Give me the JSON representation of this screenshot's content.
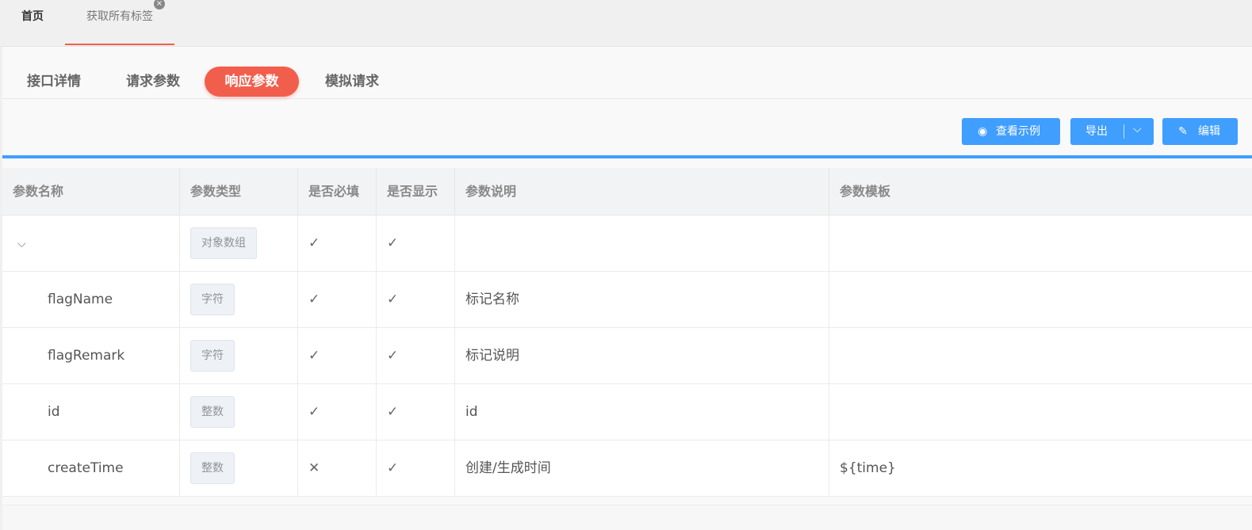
{
  "top_tabs": {
    "home": "首页",
    "active": "获取所有标签",
    "close": "×"
  },
  "sub_tabs": [
    "接口详情",
    "请求参数",
    "响应参数",
    "模拟请求"
  ],
  "toolbar": {
    "view_example": "查看示例",
    "export": "导出",
    "edit": "编辑"
  },
  "icons": {
    "eye": "◉",
    "chevron_down": "⌵",
    "pencil": "✎",
    "check": "✓",
    "cross": "✕",
    "expand": "⌵"
  },
  "colors": {
    "accent_red": "#f25e4c",
    "primary_blue": "#409eff"
  },
  "table": {
    "headers": [
      "参数名称",
      "参数类型",
      "是否必填",
      "是否显示",
      "参数说明",
      "参数模板"
    ],
    "rows": [
      {
        "name": "",
        "type": "对象数组",
        "required": "✓",
        "visible": "✓",
        "desc": "",
        "template": ""
      },
      {
        "name": "flagName",
        "type": "字符",
        "required": "✓",
        "visible": "✓",
        "desc": "标记名称",
        "template": ""
      },
      {
        "name": "flagRemark",
        "type": "字符",
        "required": "✓",
        "visible": "✓",
        "desc": "标记说明",
        "template": ""
      },
      {
        "name": "id",
        "type": "整数",
        "required": "✓",
        "visible": "✓",
        "desc": "id",
        "template": ""
      },
      {
        "name": "createTime",
        "type": "整数",
        "required": "✕",
        "visible": "✓",
        "desc": "创建/生成时间",
        "template": "${time}"
      }
    ]
  }
}
